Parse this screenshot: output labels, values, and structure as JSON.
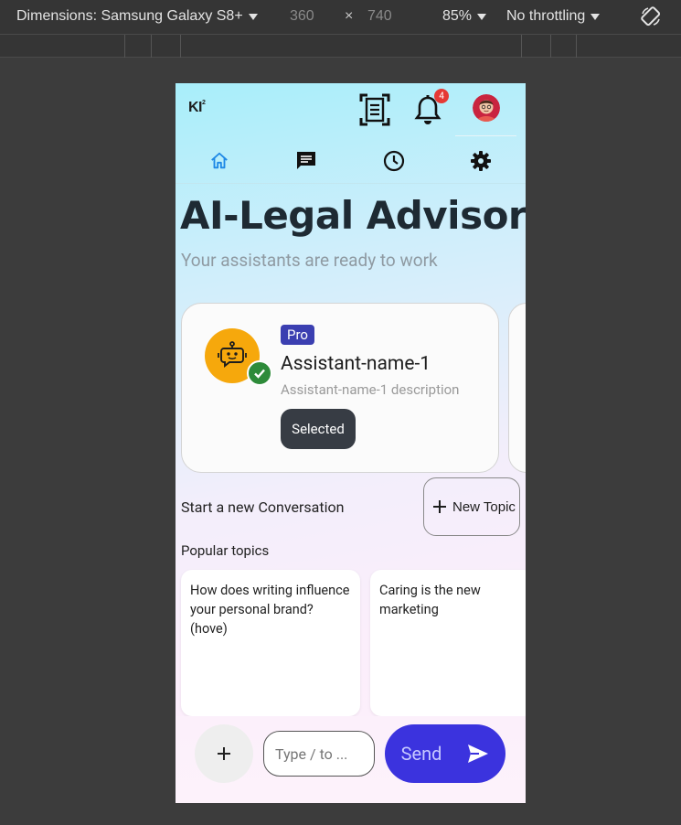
{
  "devtools": {
    "dimensions_label": "Dimensions: Samsung Galaxy S8+",
    "width": "360",
    "times": "×",
    "height": "740",
    "zoom": "85%",
    "throttling": "No throttling"
  },
  "app": {
    "logo": "KI",
    "logo_sup": "2",
    "notification_count": "4",
    "title": "AI-Legal Advisor",
    "subtitle": "Your assistants are ready to work"
  },
  "assistant_card": {
    "tier": "Pro",
    "name": "Assistant-name-1",
    "description": "Assistant-name-1 description",
    "selected_label": "Selected"
  },
  "conversation": {
    "new_conversation_label": "Start a new Conversation",
    "new_topic_label": "New Topic",
    "popular_label": "Popular topics",
    "topics": [
      {
        "text": "How does writing influence your personal brand? (hove)"
      },
      {
        "text": "Caring is the new marketing"
      }
    ]
  },
  "composer": {
    "placeholder": "Type / to ...",
    "send_label": "Send"
  },
  "colors": {
    "accent": "#3b33de",
    "pro_badge": "#3b3fb1",
    "bot_avatar": "#f6a80c",
    "check": "#2e8b3a",
    "notification_badge": "#e53935"
  }
}
